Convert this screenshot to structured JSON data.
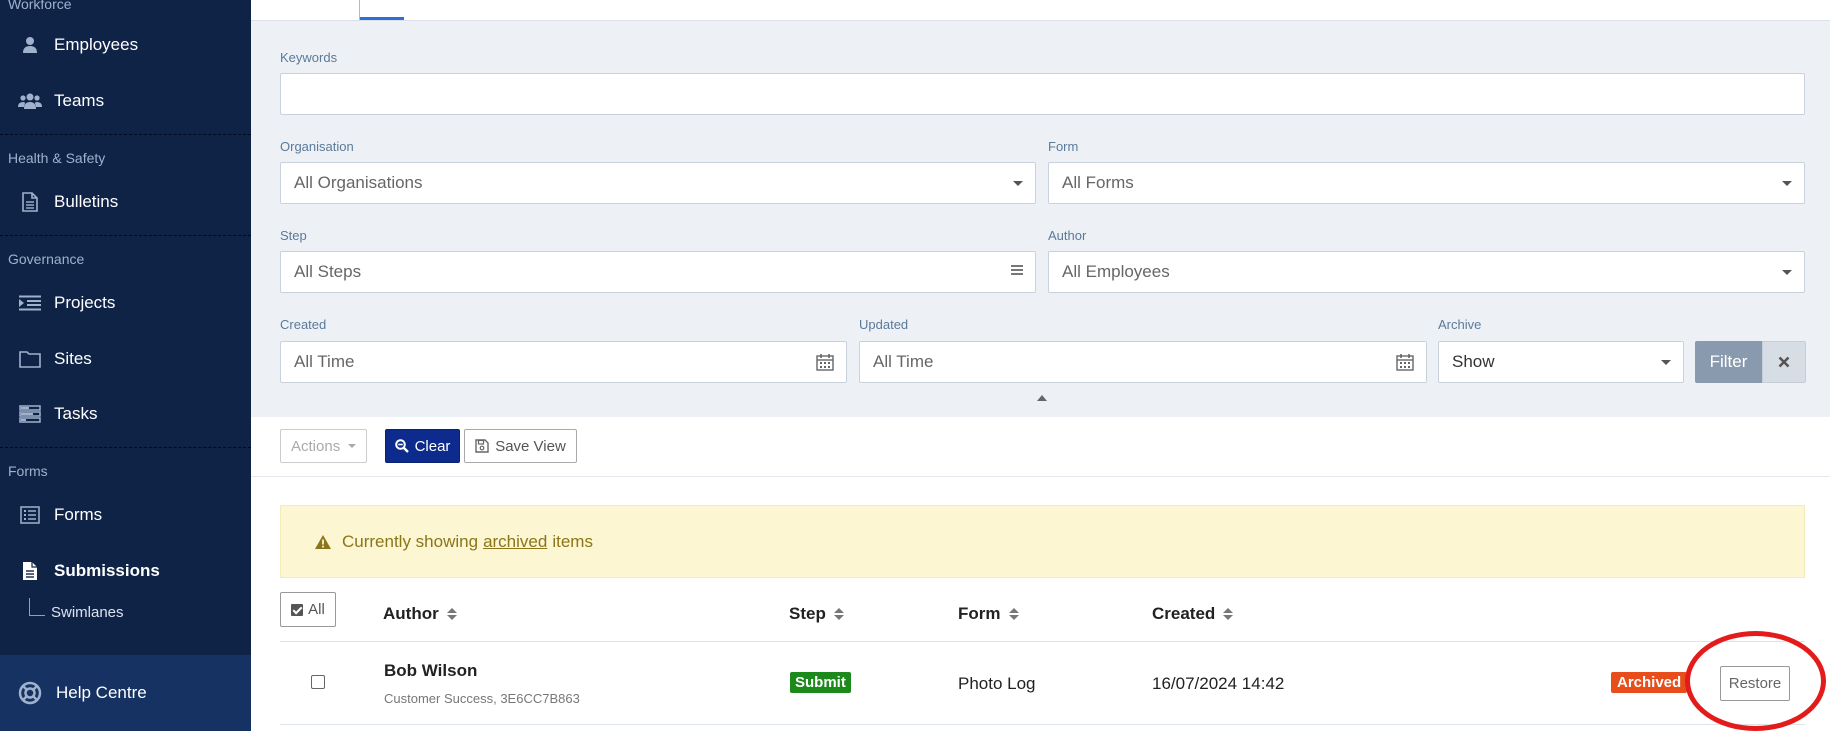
{
  "sidebar": {
    "sections": {
      "workforce": "Workforce",
      "health_safety": "Health & Safety",
      "governance": "Governance",
      "forms": "Forms"
    },
    "items": {
      "employees": "Employees",
      "teams": "Teams",
      "bulletins": "Bulletins",
      "projects": "Projects",
      "sites": "Sites",
      "tasks": "Tasks",
      "forms": "Forms",
      "submissions": "Submissions",
      "swimlanes": "Swimlanes"
    },
    "help": "Help Centre",
    "active_item": "Submissions"
  },
  "filters": {
    "keywords_label": "Keywords",
    "keywords_value": "",
    "organisation_label": "Organisation",
    "organisation_value": "All Organisations",
    "form_label": "Form",
    "form_value": "All Forms",
    "step_label": "Step",
    "step_value": "All Steps",
    "author_label": "Author",
    "author_value": "All Employees",
    "created_label": "Created",
    "created_value": "All Time",
    "updated_label": "Updated",
    "updated_value": "All Time",
    "archive_label": "Archive",
    "archive_value": "Show",
    "filter_button": "Filter"
  },
  "toolbar": {
    "actions": "Actions",
    "clear": "Clear",
    "save_view": "Save View"
  },
  "alert": {
    "prefix": "Currently showing",
    "link": "archived",
    "suffix": "items"
  },
  "table": {
    "select_all": "All",
    "columns": {
      "author": "Author",
      "step": "Step",
      "form": "Form",
      "created": "Created"
    },
    "rows": [
      {
        "author": "Bob Wilson",
        "author_meta": "Customer Success, 3E6CC7B863",
        "step": "Submit",
        "form": "Photo Log",
        "created": "16/07/2024 14:42",
        "status": "Archived",
        "action": "Restore"
      }
    ]
  },
  "colors": {
    "sidebar_bg": "#0f2347",
    "accent": "#0d2b8c",
    "step_badge": "#1b8a1b",
    "archived_badge": "#e84e1b",
    "highlight_ring": "#e41b1b"
  }
}
